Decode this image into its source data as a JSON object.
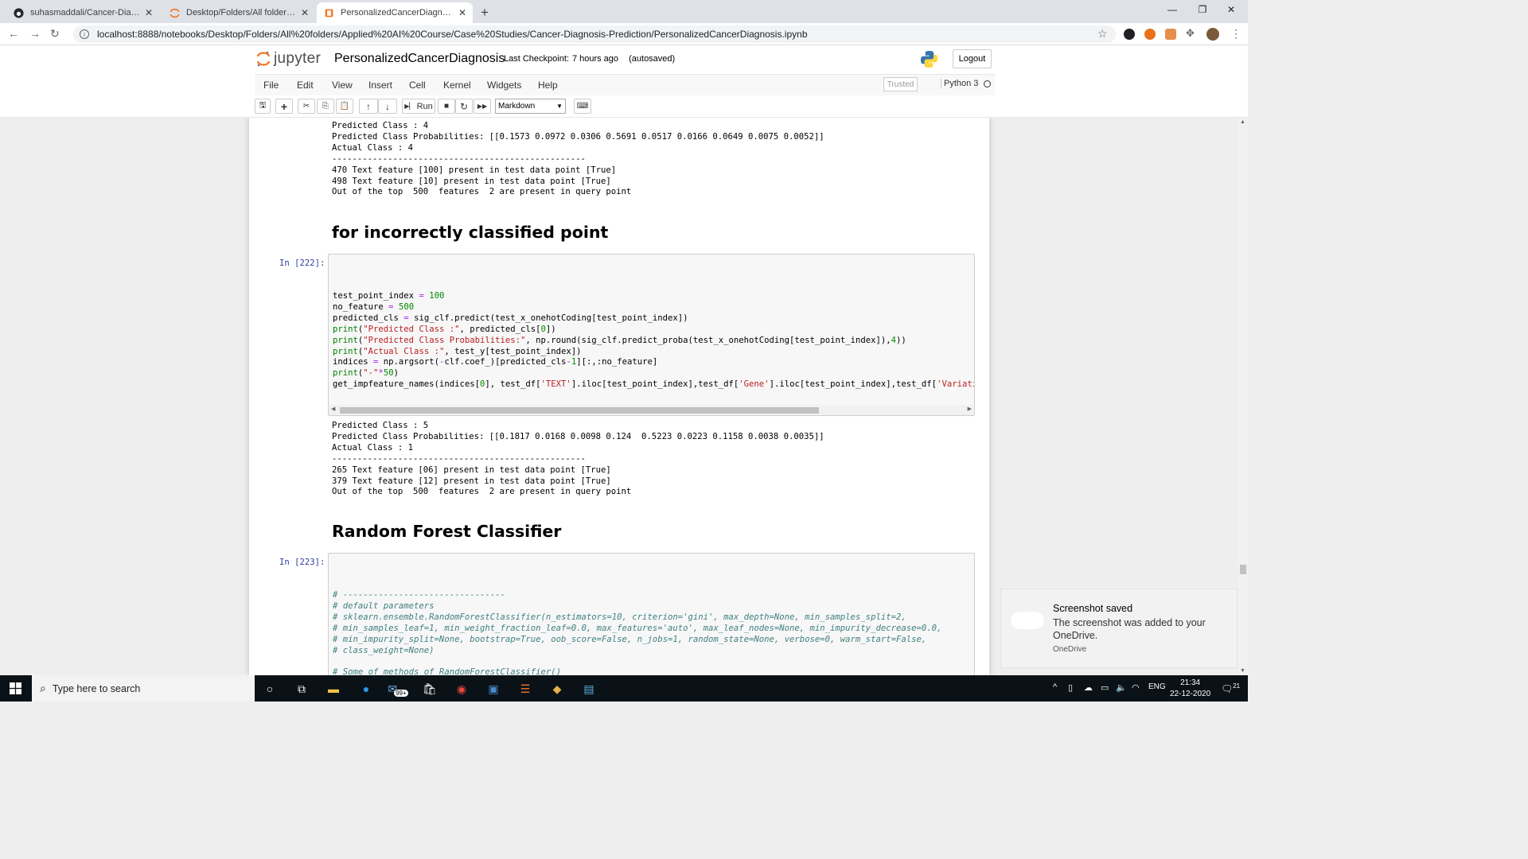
{
  "browser": {
    "tabs": [
      {
        "title": "suhasmaddali/Cancer-Diagnosis-",
        "icon": "github-icon",
        "active": false
      },
      {
        "title": "Desktop/Folders/All folders/Appl",
        "icon": "jupyter-icon",
        "active": false
      },
      {
        "title": "PersonalizedCancerDiagnosis - Ju",
        "icon": "jupyter-icon",
        "active": true
      }
    ],
    "new_tab": "+",
    "address": "localhost:8888/notebooks/Desktop/Folders/All%20folders/Applied%20AI%20Course/Case%20Studies/Cancer-Diagnosis-Prediction/PersonalizedCancerDiagnosis.ipynb"
  },
  "jupyter": {
    "logo_text": "jupyter",
    "notebook_name": "PersonalizedCancerDiagnosis",
    "checkpoint_label": "Last Checkpoint:",
    "checkpoint_time": "7 hours ago",
    "save_status": "(autosaved)",
    "logout_label": "Logout",
    "menu": [
      "File",
      "Edit",
      "View",
      "Insert",
      "Cell",
      "Kernel",
      "Widgets",
      "Help"
    ],
    "trusted_label": "Trusted",
    "kernel_name": "Python 3",
    "run_label": "Run",
    "cell_type": "Markdown"
  },
  "notebook": {
    "output_top": [
      "Predicted Class : 4",
      "Predicted Class Probabilities: [[0.1573 0.0972 0.0306 0.5691 0.0517 0.0166 0.0649 0.0075 0.0052]]",
      "Actual Class : 4",
      "--------------------------------------------------",
      "470 Text feature [100] present in test data point [True]",
      "498 Text feature [10] present in test data point [True]",
      "Out of the top  500  features  2 are present in query point"
    ],
    "heading1": "for incorrectly classified point",
    "cell1_prompt": "In [222]:",
    "output_mid": [
      "Predicted Class : 5",
      "Predicted Class Probabilities: [[0.1817 0.0168 0.0098 0.124  0.5223 0.0223 0.1158 0.0038 0.0035]]",
      "Actual Class : 1",
      "--------------------------------------------------",
      "265 Text feature [06] present in test data point [True]",
      "379 Text feature [12] present in test data point [True]",
      "Out of the top  500  features  2 are present in query point"
    ],
    "heading2": "Random Forest Classifier",
    "cell2_prompt": "In [223]:",
    "cell2_comments": [
      "# --------------------------------",
      "# default parameters",
      "# sklearn.ensemble.RandomForestClassifier(n_estimators=10, criterion='gini', max_depth=None, min_samples_split=2,",
      "# min_samples_leaf=1, min_weight_fraction_leaf=0.0, max_features='auto', max_leaf_nodes=None, min_impurity_decrease=0.0,",
      "# min_impurity_split=None, bootstrap=True, oob_score=False, n_jobs=1, random_state=None, verbose=0, warm_start=False,",
      "# class_weight=None)",
      "",
      "# Some of methods of RandomForestClassifier()"
    ]
  },
  "toast": {
    "title": "Screenshot saved",
    "body": "The screenshot was added to your OneDrive.",
    "source": "OneDrive"
  },
  "taskbar": {
    "search_placeholder": "Type here to search",
    "mail_badge": "99+",
    "language": "ENG",
    "time": "21:34",
    "date": "22-12-2020",
    "notification_count": "21"
  }
}
